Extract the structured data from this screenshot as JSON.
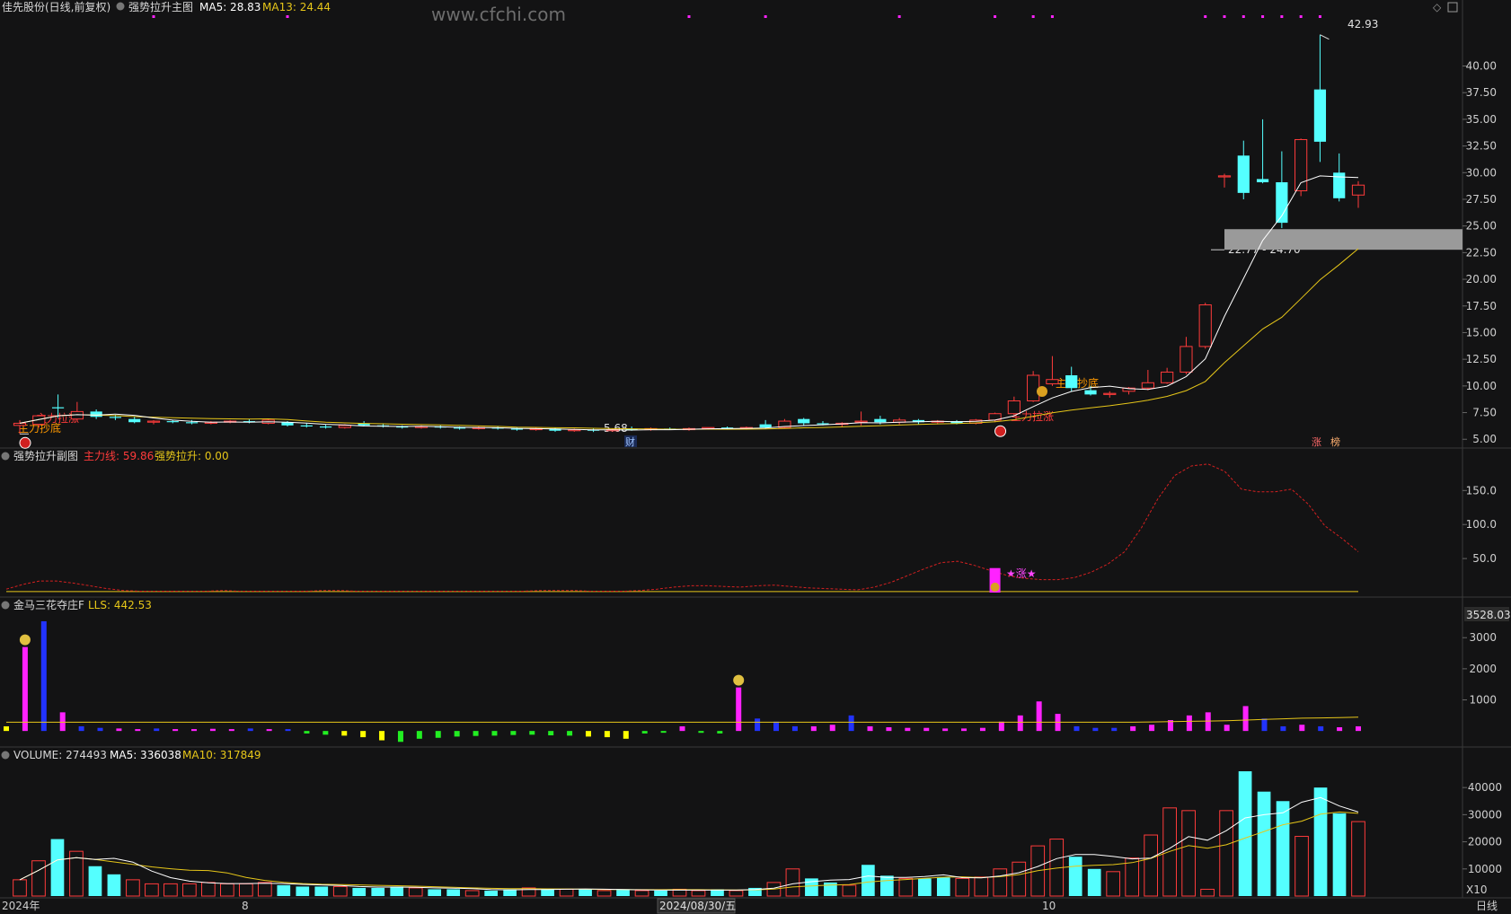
{
  "watermark": "www.cfchi.com",
  "colors": {
    "up": "#ff3b3b",
    "down": "#54ffff",
    "ma_white": "#ffffff",
    "ma_yellow": "#e6c619",
    "magenta": "#ff22ff",
    "blue": "#2233ff",
    "green": "#22ee22",
    "yellow": "#ffff00",
    "band": "#9a9a9a"
  },
  "main": {
    "name": "佳先股份(日线,前复权)",
    "indicator": "强势拉升主图",
    "ma5_label": "MA5: 28.83",
    "ma13_label": "MA13: 24.44",
    "high_label": "42.93",
    "low_label": "5.68",
    "band_label": "22.77 - 24.70",
    "signal_texts": [
      "主力抄底",
      "主力拉涨",
      "主力抄底",
      "主力拉涨"
    ],
    "badge_cai": "财",
    "badge_zhang": "涨",
    "badge_bang": "榜"
  },
  "sub1": {
    "title": "强势拉升副图",
    "line_label": "主力线: 59.86",
    "pull_label": "强势拉升: 0.00",
    "star_text": "★涨★"
  },
  "sub2": {
    "title": "金马三花夺庄F",
    "lls_label": "LLS: 442.53",
    "max_label": "3528.03"
  },
  "volume": {
    "title": "VOLUME: 274493",
    "ma5_label": "MA5: 336038",
    "ma10_label": "MA10: 317849",
    "unit": "X10"
  },
  "xaxis": {
    "labels": [
      "2024年",
      "8",
      "2024/08/30/五",
      "10",
      "日线"
    ]
  },
  "chart_data": [
    {
      "type": "candlestick",
      "title": "强势拉升主图",
      "ylim": [
        4.6,
        44.0
      ],
      "yticks": [
        5.0,
        7.5,
        10.0,
        12.5,
        15.0,
        17.5,
        20.0,
        22.5,
        25.0,
        27.5,
        30.0,
        32.5,
        35.0,
        37.5,
        40.0
      ],
      "band": [
        22.77,
        24.7
      ],
      "candles": [
        {
          "o": 6.3,
          "h": 6.8,
          "l": 5.5,
          "c": 6.5
        },
        {
          "o": 6.4,
          "h": 7.0,
          "l": 6.1,
          "c": 7.2
        },
        {
          "o": 8.0,
          "h": 9.2,
          "l": 7.0,
          "c": 7.9
        },
        {
          "o": 6.9,
          "h": 8.5,
          "l": 6.7,
          "c": 7.6
        },
        {
          "o": 7.6,
          "h": 7.8,
          "l": 6.9,
          "c": 7.1
        },
        {
          "o": 7.1,
          "h": 7.3,
          "l": 6.8,
          "c": 7.0
        },
        {
          "o": 6.9,
          "h": 7.1,
          "l": 6.5,
          "c": 6.6
        },
        {
          "o": 6.6,
          "h": 6.8,
          "l": 6.4,
          "c": 6.7
        },
        {
          "o": 6.7,
          "h": 6.8,
          "l": 6.5,
          "c": 6.6
        },
        {
          "o": 6.6,
          "h": 6.8,
          "l": 6.4,
          "c": 6.5
        },
        {
          "o": 6.5,
          "h": 6.7,
          "l": 6.4,
          "c": 6.6
        },
        {
          "o": 6.6,
          "h": 6.8,
          "l": 6.5,
          "c": 6.7
        },
        {
          "o": 6.7,
          "h": 6.9,
          "l": 6.5,
          "c": 6.6
        },
        {
          "o": 6.5,
          "h": 6.9,
          "l": 6.4,
          "c": 6.8
        },
        {
          "o": 6.6,
          "h": 6.7,
          "l": 6.2,
          "c": 6.3
        },
        {
          "o": 6.3,
          "h": 6.5,
          "l": 6.1,
          "c": 6.2
        },
        {
          "o": 6.2,
          "h": 6.4,
          "l": 6.0,
          "c": 6.1
        },
        {
          "o": 6.1,
          "h": 6.4,
          "l": 6.0,
          "c": 6.3
        },
        {
          "o": 6.5,
          "h": 6.7,
          "l": 6.2,
          "c": 6.3
        },
        {
          "o": 6.3,
          "h": 6.5,
          "l": 6.1,
          "c": 6.2
        },
        {
          "o": 6.2,
          "h": 6.3,
          "l": 6.0,
          "c": 6.1
        },
        {
          "o": 6.1,
          "h": 6.3,
          "l": 6.0,
          "c": 6.2
        },
        {
          "o": 6.2,
          "h": 6.3,
          "l": 6.0,
          "c": 6.1
        },
        {
          "o": 6.1,
          "h": 6.2,
          "l": 5.9,
          "c": 6.0
        },
        {
          "o": 6.0,
          "h": 6.2,
          "l": 5.9,
          "c": 6.1
        },
        {
          "o": 6.1,
          "h": 6.2,
          "l": 5.9,
          "c": 6.0
        },
        {
          "o": 6.0,
          "h": 6.1,
          "l": 5.8,
          "c": 5.9
        },
        {
          "o": 5.9,
          "h": 6.1,
          "l": 5.8,
          "c": 6.0
        },
        {
          "o": 6.0,
          "h": 6.1,
          "l": 5.7,
          "c": 5.8
        },
        {
          "o": 5.8,
          "h": 6.0,
          "l": 5.7,
          "c": 5.9
        },
        {
          "o": 5.9,
          "h": 6.0,
          "l": 5.68,
          "c": 5.8
        },
        {
          "o": 5.8,
          "h": 6.0,
          "l": 5.7,
          "c": 5.9
        },
        {
          "o": 6.0,
          "h": 6.2,
          "l": 5.8,
          "c": 5.9
        },
        {
          "o": 5.9,
          "h": 6.1,
          "l": 5.8,
          "c": 6.0
        },
        {
          "o": 6.0,
          "h": 6.1,
          "l": 5.9,
          "c": 5.9
        },
        {
          "o": 5.9,
          "h": 6.1,
          "l": 5.8,
          "c": 6.0
        },
        {
          "o": 6.0,
          "h": 6.1,
          "l": 5.9,
          "c": 6.1
        },
        {
          "o": 6.1,
          "h": 6.2,
          "l": 5.9,
          "c": 6.0
        },
        {
          "o": 6.0,
          "h": 6.2,
          "l": 5.9,
          "c": 6.1
        },
        {
          "o": 6.4,
          "h": 6.8,
          "l": 6.0,
          "c": 6.1
        },
        {
          "o": 6.1,
          "h": 6.9,
          "l": 6.0,
          "c": 6.7
        },
        {
          "o": 6.9,
          "h": 7.0,
          "l": 6.3,
          "c": 6.5
        },
        {
          "o": 6.5,
          "h": 6.7,
          "l": 6.3,
          "c": 6.4
        },
        {
          "o": 6.4,
          "h": 6.6,
          "l": 6.2,
          "c": 6.5
        },
        {
          "o": 6.6,
          "h": 7.6,
          "l": 6.3,
          "c": 6.7
        },
        {
          "o": 6.9,
          "h": 7.2,
          "l": 6.4,
          "c": 6.6
        },
        {
          "o": 6.6,
          "h": 7.0,
          "l": 6.4,
          "c": 6.8
        },
        {
          "o": 6.8,
          "h": 6.9,
          "l": 6.4,
          "c": 6.6
        },
        {
          "o": 6.6,
          "h": 6.8,
          "l": 6.4,
          "c": 6.7
        },
        {
          "o": 6.7,
          "h": 6.8,
          "l": 6.4,
          "c": 6.5
        },
        {
          "o": 6.5,
          "h": 6.9,
          "l": 6.4,
          "c": 6.8
        },
        {
          "o": 6.8,
          "h": 7.5,
          "l": 6.6,
          "c": 7.4
        },
        {
          "o": 7.4,
          "h": 9.0,
          "l": 7.2,
          "c": 8.6
        },
        {
          "o": 8.6,
          "h": 11.4,
          "l": 8.5,
          "c": 11.0
        },
        {
          "o": 10.2,
          "h": 12.8,
          "l": 10.0,
          "c": 10.6
        },
        {
          "o": 11.0,
          "h": 11.8,
          "l": 9.5,
          "c": 9.8
        },
        {
          "o": 9.6,
          "h": 10.0,
          "l": 9.1,
          "c": 9.2
        },
        {
          "o": 9.2,
          "h": 9.5,
          "l": 8.9,
          "c": 9.3
        },
        {
          "o": 9.5,
          "h": 9.9,
          "l": 9.2,
          "c": 9.8
        },
        {
          "o": 9.8,
          "h": 11.5,
          "l": 9.6,
          "c": 10.3
        },
        {
          "o": 10.3,
          "h": 11.7,
          "l": 10.2,
          "c": 11.3
        },
        {
          "o": 11.3,
          "h": 14.6,
          "l": 11.1,
          "c": 13.7
        },
        {
          "o": 13.7,
          "h": 17.8,
          "l": 13.5,
          "c": 17.6
        },
        {
          "o": 29.6,
          "h": 29.9,
          "l": 28.6,
          "c": 29.7
        },
        {
          "o": 31.6,
          "h": 33.0,
          "l": 27.5,
          "c": 28.1
        },
        {
          "o": 29.4,
          "h": 35.0,
          "l": 29.0,
          "c": 29.1
        },
        {
          "o": 29.1,
          "h": 32.0,
          "l": 24.8,
          "c": 25.3
        },
        {
          "o": 28.3,
          "h": 33.2,
          "l": 27.8,
          "c": 33.1
        },
        {
          "o": 37.8,
          "h": 42.93,
          "l": 31.0,
          "c": 32.9
        },
        {
          "o": 30.0,
          "h": 31.8,
          "l": 27.3,
          "c": 27.6
        },
        {
          "o": 27.9,
          "h": 29.2,
          "l": 26.7,
          "c": 28.83
        }
      ]
    },
    {
      "type": "line",
      "title": "强势拉升副图",
      "series_name": "主力线",
      "ylim": [
        0,
        190
      ],
      "yticks": [
        50.0,
        100.0,
        150.0
      ],
      "values": [
        5,
        12,
        17,
        17,
        14,
        10,
        6,
        3,
        2,
        2,
        2,
        2,
        2,
        3,
        2,
        2,
        2,
        2,
        2,
        3,
        3,
        2,
        2,
        2,
        2,
        2,
        2,
        2,
        2,
        2,
        2,
        2,
        3,
        3,
        3,
        2,
        2,
        2,
        3,
        5,
        8,
        10,
        10,
        9,
        8,
        10,
        11,
        9,
        7,
        6,
        5,
        4,
        8,
        15,
        25,
        35,
        44,
        46,
        40,
        32,
        25,
        21,
        19,
        19,
        22,
        30,
        42,
        60,
        95,
        138,
        172,
        186,
        189,
        178,
        152,
        148,
        148,
        152,
        130,
        98,
        80,
        60
      ],
      "signal": {
        "index": 51,
        "value": 36,
        "label": "★涨★"
      }
    },
    {
      "type": "bar",
      "title": "金马三花夺庄F",
      "series_name": "LLS",
      "ylim": [
        -400,
        3700
      ],
      "yticks": [
        1000,
        2000,
        3000
      ],
      "values": [
        150,
        2700,
        3528,
        600,
        150,
        100,
        80,
        60,
        80,
        60,
        60,
        70,
        60,
        80,
        60,
        60,
        -80,
        -120,
        -150,
        -200,
        -300,
        -350,
        -250,
        -220,
        -180,
        -160,
        -150,
        -130,
        -120,
        -140,
        -150,
        -180,
        -200,
        -250,
        -80,
        -50,
        150,
        -60,
        -80,
        1400,
        400,
        300,
        150,
        150,
        200,
        500,
        150,
        120,
        100,
        100,
        80,
        80,
        100,
        300,
        500,
        950,
        550,
        150,
        100,
        100,
        150,
        200,
        350,
        500,
        600,
        200,
        800,
        400,
        150,
        200,
        150,
        120,
        150
      ],
      "colors": [
        "yellow",
        "magenta",
        "blue",
        "magenta",
        "blue",
        "blue",
        "magenta",
        "magenta",
        "blue",
        "magenta",
        "magenta",
        "magenta",
        "magenta",
        "blue",
        "magenta",
        "blue",
        "green",
        "green",
        "yellow",
        "yellow",
        "yellow",
        "green",
        "green",
        "green",
        "green",
        "green",
        "green",
        "green",
        "green",
        "green",
        "green",
        "yellow",
        "yellow",
        "yellow",
        "green",
        "green",
        "magenta",
        "green",
        "green",
        "magenta",
        "blue",
        "blue",
        "blue",
        "magenta",
        "magenta",
        "blue",
        "magenta",
        "magenta",
        "magenta",
        "magenta",
        "magenta",
        "magenta",
        "magenta",
        "magenta",
        "magenta",
        "magenta",
        "magenta",
        "blue",
        "blue",
        "blue",
        "magenta",
        "magenta",
        "magenta",
        "magenta",
        "magenta",
        "magenta",
        "magenta",
        "blue",
        "blue",
        "magenta",
        "blue",
        "magenta",
        "magenta"
      ],
      "lls_line": [
        280,
        280,
        280,
        280,
        280,
        280,
        280,
        280,
        280,
        280,
        280,
        280,
        280,
        280,
        280,
        280,
        280,
        280,
        280,
        280,
        280,
        280,
        280,
        280,
        280,
        280,
        280,
        280,
        280,
        280,
        280,
        280,
        280,
        280,
        280,
        280,
        280,
        280,
        280,
        280,
        280,
        280,
        280,
        280,
        280,
        280,
        280,
        280,
        280,
        280,
        280,
        280,
        280,
        280,
        280,
        280,
        280,
        280,
        280,
        280,
        280,
        290,
        300,
        310,
        320,
        330,
        350,
        370,
        390,
        410,
        420,
        430,
        442.53
      ]
    },
    {
      "type": "bar",
      "title": "VOLUME",
      "ylim": [
        0,
        48000
      ],
      "yticks": [
        10000,
        20000,
        30000,
        40000
      ],
      "unit": "X10",
      "values": [
        6000,
        13000,
        21000,
        16500,
        11000,
        8000,
        6000,
        4500,
        4500,
        4500,
        5000,
        4500,
        4500,
        5000,
        4000,
        3500,
        3500,
        3500,
        3000,
        3000,
        3500,
        3000,
        2500,
        2500,
        2000,
        2000,
        2500,
        3000,
        2500,
        2500,
        2500,
        2000,
        2500,
        2000,
        2000,
        2500,
        2000,
        2500,
        2000,
        3000,
        5000,
        10000,
        6500,
        5000,
        4000,
        11500,
        7500,
        6500,
        6500,
        7000,
        6500,
        7000,
        10000,
        12500,
        18500,
        21000,
        14500,
        10000,
        9000,
        14000,
        22500,
        32500,
        31500,
        2500,
        31500,
        46000,
        38500,
        35000,
        22000,
        40000,
        30500,
        27449
      ],
      "up": [
        1,
        1,
        0,
        1,
        0,
        0,
        1,
        1,
        1,
        1,
        1,
        1,
        1,
        1,
        0,
        0,
        0,
        1,
        0,
        0,
        0,
        1,
        0,
        0,
        1,
        0,
        0,
        1,
        0,
        1,
        0,
        1,
        0,
        1,
        0,
        1,
        1,
        0,
        1,
        0,
        1,
        1,
        0,
        0,
        1,
        0,
        0,
        1,
        0,
        0,
        1,
        1,
        1,
        1,
        1,
        1,
        0,
        0,
        1,
        1,
        1,
        1,
        1,
        1,
        1,
        0,
        0,
        0,
        1,
        0,
        0,
        1
      ],
      "ma5_label": "MA5: 336038",
      "ma10_label": "MA10: 317849"
    }
  ]
}
